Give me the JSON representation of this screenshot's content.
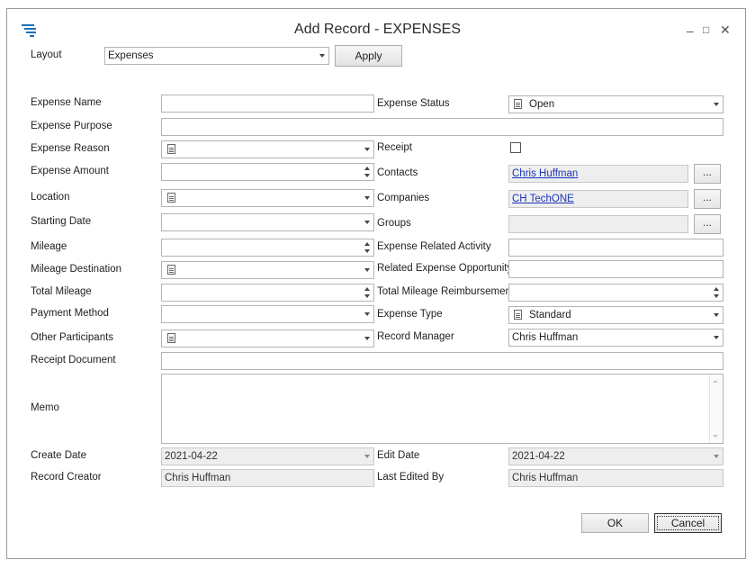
{
  "window": {
    "title": "Add Record - EXPENSES",
    "logo": "grid-logo-icon",
    "controls": {
      "minimize": "–",
      "maximize": "□",
      "close": "✕"
    }
  },
  "layout": {
    "label": "Layout",
    "value": "Expenses",
    "apply": "Apply"
  },
  "left": [
    {
      "label": "Expense Name",
      "kind": "text",
      "value": ""
    },
    {
      "label": "Expense Purpose",
      "kind": "text-wide",
      "value": ""
    },
    {
      "label": "Expense Reason",
      "kind": "doc-dropdown",
      "value": ""
    },
    {
      "label": "Expense Amount",
      "kind": "spin",
      "value": ""
    },
    {
      "label": "Location",
      "kind": "doc-dropdown",
      "value": ""
    },
    {
      "label": "Starting Date",
      "kind": "dropdown",
      "value": ""
    },
    {
      "label": "Mileage",
      "kind": "spin",
      "value": ""
    },
    {
      "label": "Mileage Destination",
      "kind": "doc-dropdown",
      "value": ""
    },
    {
      "label": "Total Mileage",
      "kind": "spin",
      "value": ""
    },
    {
      "label": "Payment Method",
      "kind": "dropdown",
      "value": ""
    },
    {
      "label": "Other Participants",
      "kind": "doc-dropdown",
      "value": ""
    },
    {
      "label": "Receipt Document",
      "kind": "text-wide",
      "value": ""
    },
    {
      "label": "Memo",
      "kind": "memo",
      "value": ""
    },
    {
      "label": "Create Date",
      "kind": "dropdown-ro",
      "value": "2021-04-22"
    },
    {
      "label": "Record Creator",
      "kind": "text-ro",
      "value": "Chris Huffman"
    }
  ],
  "right": {
    "expense_status": {
      "label": "Expense Status",
      "value": "Open"
    },
    "receipt": {
      "label": "Receipt",
      "checked": false
    },
    "contacts": {
      "label": "Contacts",
      "value": "Chris Huffman",
      "ellipsis": "..."
    },
    "companies": {
      "label": "Companies",
      "value": "CH TechONE",
      "ellipsis": "..."
    },
    "groups": {
      "label": "Groups",
      "value": "",
      "ellipsis": "..."
    },
    "related_activity": {
      "label": "Expense Related Activity",
      "value": ""
    },
    "related_opportunity": {
      "label": "Related Expense Opportunity",
      "value": ""
    },
    "total_reimbursement": {
      "label": "Total Mileage Reimbursement",
      "value": ""
    },
    "expense_type": {
      "label": "Expense Type",
      "value": "Standard"
    },
    "record_manager": {
      "label": "Record Manager",
      "value": "Chris Huffman"
    },
    "edit_date": {
      "label": "Edit Date",
      "value": "2021-04-22"
    },
    "last_edited_by": {
      "label": "Last Edited By",
      "value": "Chris Huffman"
    }
  },
  "footer": {
    "ok": "OK",
    "cancel": "Cancel"
  },
  "colors": {
    "link": "#1a34b8",
    "logo": "#1e6fb8",
    "readonly_bg": "#eeeeee"
  }
}
